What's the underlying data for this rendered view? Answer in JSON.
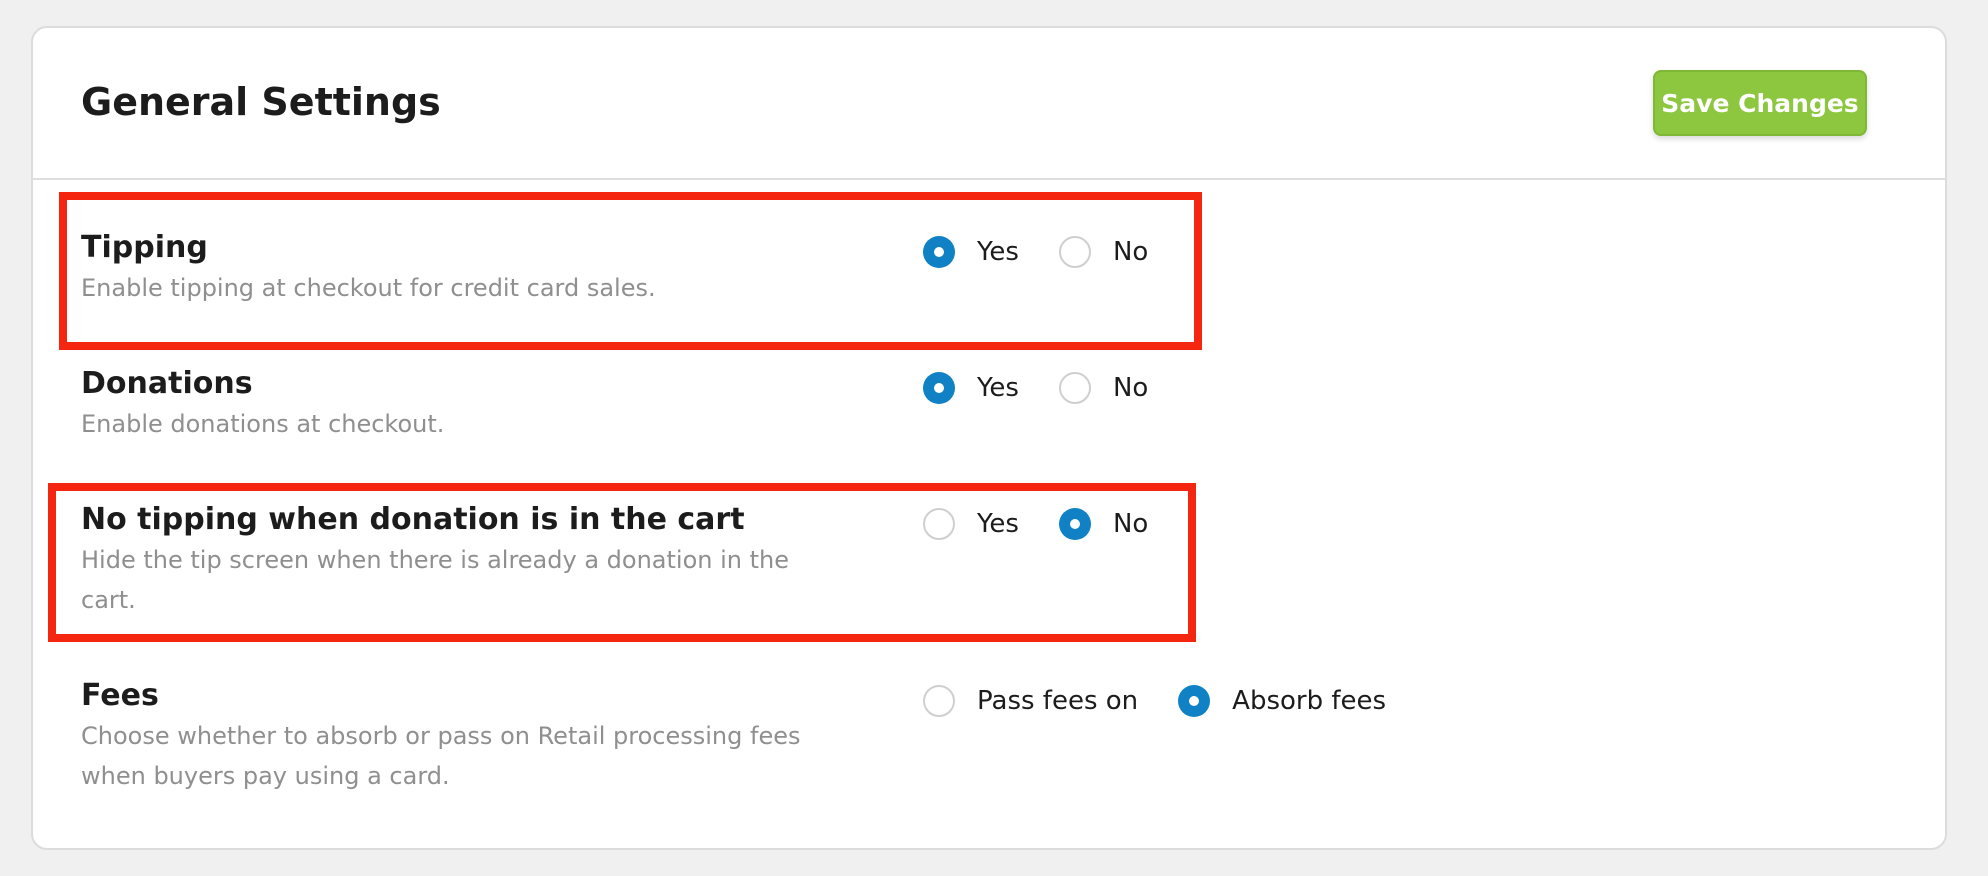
{
  "header": {
    "title": "General Settings",
    "save_label": "Save Changes"
  },
  "settings": [
    {
      "title": "Tipping",
      "description": "Enable tipping at checkout for credit card sales.",
      "options": [
        "Yes",
        "No"
      ],
      "selected": "Yes",
      "highlighted": true
    },
    {
      "title": "Donations",
      "description": "Enable donations at checkout.",
      "options": [
        "Yes",
        "No"
      ],
      "selected": "Yes",
      "highlighted": false
    },
    {
      "title": "No tipping when donation is in the cart",
      "description": "Hide the tip screen when there is already a donation in the cart.",
      "options": [
        "Yes",
        "No"
      ],
      "selected": "No",
      "highlighted": true
    },
    {
      "title": "Fees",
      "description": "Choose whether to absorb or pass on Retail processing fees when buyers pay using a card.",
      "options": [
        "Pass fees on",
        "Absorb fees"
      ],
      "selected": "Absorb fees",
      "highlighted": false
    }
  ],
  "colors": {
    "accent": "#1181c6",
    "save_button": "#8dc63f",
    "highlight": "#f5260f"
  }
}
